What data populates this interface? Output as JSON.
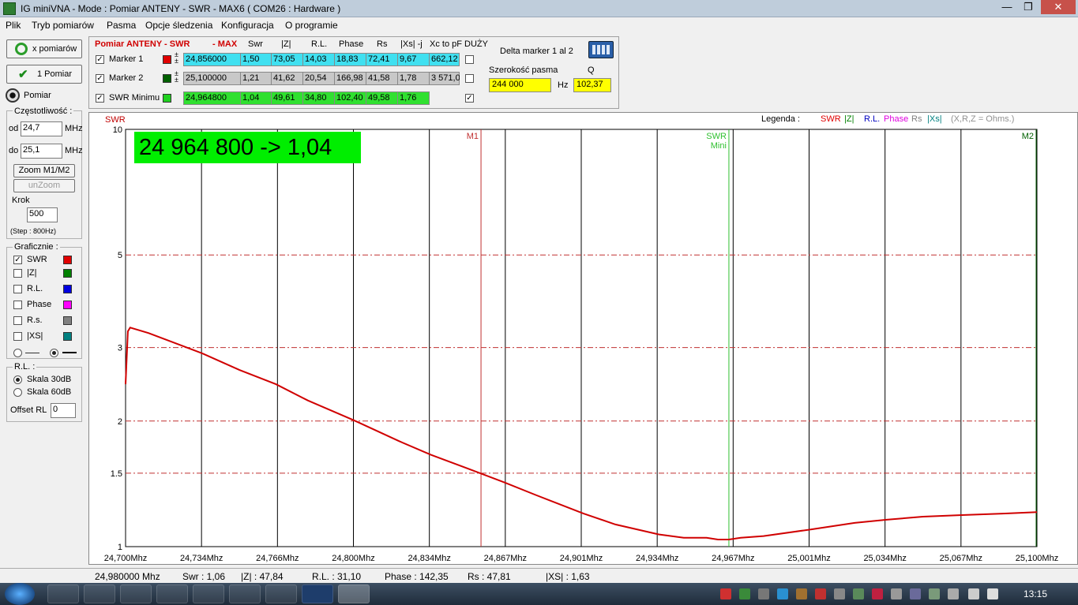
{
  "window": {
    "title": "IG miniVNA - Mode : Pomiar ANTENY - SWR    - MAX6 ( COM26 :  Hardware )"
  },
  "menu": [
    "Plik",
    "Tryb pomiarów",
    "Pasma",
    "Opcje śledzenia",
    "Konfiguracja",
    "O programie"
  ],
  "left": {
    "btn_multi": "x pomiarów",
    "btn_single": "1 Pomiar",
    "pomiar_label": "Pomiar",
    "freq_group": "Częstotliwość :",
    "od_label": "od",
    "od_value": "24,7",
    "od_unit": "MHz",
    "do_label": "do",
    "do_value": "25,1",
    "do_unit": "MHz",
    "zoom_btn": "Zoom M1/M2",
    "unzoom_btn": "unZoom",
    "krok_label": "Krok",
    "krok_value": "500",
    "step_text": "(Step : 800Hz)",
    "graf_group": "Graficznie :",
    "graphs": [
      {
        "label": "SWR",
        "checked": "✓",
        "color": "#e00000"
      },
      {
        "label": "|Z|",
        "checked": "",
        "color": "#008000"
      },
      {
        "label": "R.L.",
        "checked": "",
        "color": "#0000e0"
      },
      {
        "label": "Phase",
        "checked": "",
        "color": "#ff00ff"
      },
      {
        "label": "R.s.",
        "checked": "",
        "color": "#808080"
      },
      {
        "label": "|XS|",
        "checked": "",
        "color": "#008080"
      }
    ],
    "rl_group": "R.L. :",
    "rl_30": "Skala 30dB",
    "rl_60": "Skala 60dB",
    "offset_label": "Offset RL",
    "offset_value": "0"
  },
  "top": {
    "title": "Pomiar ANTENY - SWR",
    "max": "- MAX",
    "headers": [
      "Swr",
      "|Z|",
      "R.L.",
      "Phase",
      "Rs",
      "|Xs| -j",
      "Xc to pF",
      "DUŻY"
    ],
    "rows": [
      {
        "label": "Marker 1",
        "checked": "✓",
        "swatch": "#e00000",
        "bg": "#40e0f0",
        "values": [
          "24,856000",
          "1,50",
          "73,05",
          "14,03",
          "18,83",
          "72,41",
          "9,67",
          "662,12"
        ]
      },
      {
        "label": "Marker 2",
        "checked": "✓",
        "swatch": "#006000",
        "bg": "#c8c8c8",
        "values": [
          "25,100000",
          "1,21",
          "41,62",
          "20,54",
          "166,98",
          "41,58",
          "1,78",
          "3 571,0"
        ]
      },
      {
        "label": "SWR Minimu",
        "checked": "✓",
        "swatch": "#20d020",
        "bg": "#30e030",
        "values": [
          "24,964800",
          "1,04",
          "49,61",
          "34,80",
          "102,40",
          "49,58",
          "1,76",
          ""
        ]
      }
    ],
    "duzy_checks": [
      "",
      "",
      "✓"
    ],
    "delta_label": "Delta marker 1 al 2",
    "szer_label": "Szerokość pasma",
    "szer_value": "244 000",
    "hz": "Hz",
    "q_label": "Q",
    "q_value": "102,37"
  },
  "chart_data": {
    "type": "line",
    "ylabel": "SWR",
    "yscale": "log",
    "ylim": [
      1,
      10
    ],
    "yticks": [
      "10",
      "5",
      "3",
      "2",
      "1.5",
      "1"
    ],
    "xlim": [
      24.7,
      25.1
    ],
    "xticks": [
      "24,700Mhz",
      "24,734Mhz",
      "24,766Mhz",
      "24,800Mhz",
      "24,834Mhz",
      "24,867Mhz",
      "24,901Mhz",
      "24,934Mhz",
      "24,967Mhz",
      "25,001Mhz",
      "25,034Mhz",
      "25,067Mhz",
      "25,100Mhz"
    ],
    "legend_title": "Legenda :",
    "legend": [
      {
        "text": "SWR",
        "color": "#e00000"
      },
      {
        "text": "|Z|",
        "color": "#008000"
      },
      {
        "text": "R.L.",
        "color": "#0000c0"
      },
      {
        "text": "Phase",
        "color": "#e000e0"
      },
      {
        "text": "Rs",
        "color": "#808080"
      },
      {
        "text": "|Xs|",
        "color": "#008080"
      },
      {
        "text": "(X,R,Z = Ohms.)",
        "color": "#909090"
      }
    ],
    "readout": "24 964 800 -> 1,04",
    "markers": [
      {
        "label": "M1",
        "x": 24.856,
        "color": "#c03030"
      },
      {
        "label": "SWR Mini",
        "x": 24.9648,
        "color": "#30c030"
      },
      {
        "label": "M2",
        "x": 25.1,
        "color": "#006000"
      }
    ],
    "series": [
      {
        "color": "#d00000",
        "x": [
          24.7,
          24.701,
          24.702,
          24.71,
          24.72,
          24.734,
          24.75,
          24.766,
          24.78,
          24.8,
          24.82,
          24.834,
          24.85,
          24.867,
          24.88,
          24.901,
          24.915,
          24.934,
          24.945,
          24.955,
          24.96,
          24.9648,
          24.97,
          24.98,
          25.001,
          25.02,
          25.034,
          25.05,
          25.067,
          25.085,
          25.1
        ],
        "y": [
          2.45,
          3.28,
          3.35,
          3.25,
          3.1,
          2.9,
          2.65,
          2.45,
          2.24,
          2.01,
          1.79,
          1.66,
          1.54,
          1.42,
          1.33,
          1.2,
          1.13,
          1.07,
          1.05,
          1.05,
          1.04,
          1.04,
          1.05,
          1.06,
          1.1,
          1.14,
          1.16,
          1.18,
          1.19,
          1.2,
          1.21
        ]
      }
    ]
  },
  "status": {
    "freq": "24,980000 Mhz",
    "swr": "Swr : 1,06",
    "z": "|Z| : 47,84",
    "rl": "R.L. : 31,10",
    "phase": "Phase : 142,35",
    "rs": "Rs : 47,81",
    "xs": "|XS| : 1,63"
  },
  "taskbar": {
    "clock": "13:15"
  }
}
